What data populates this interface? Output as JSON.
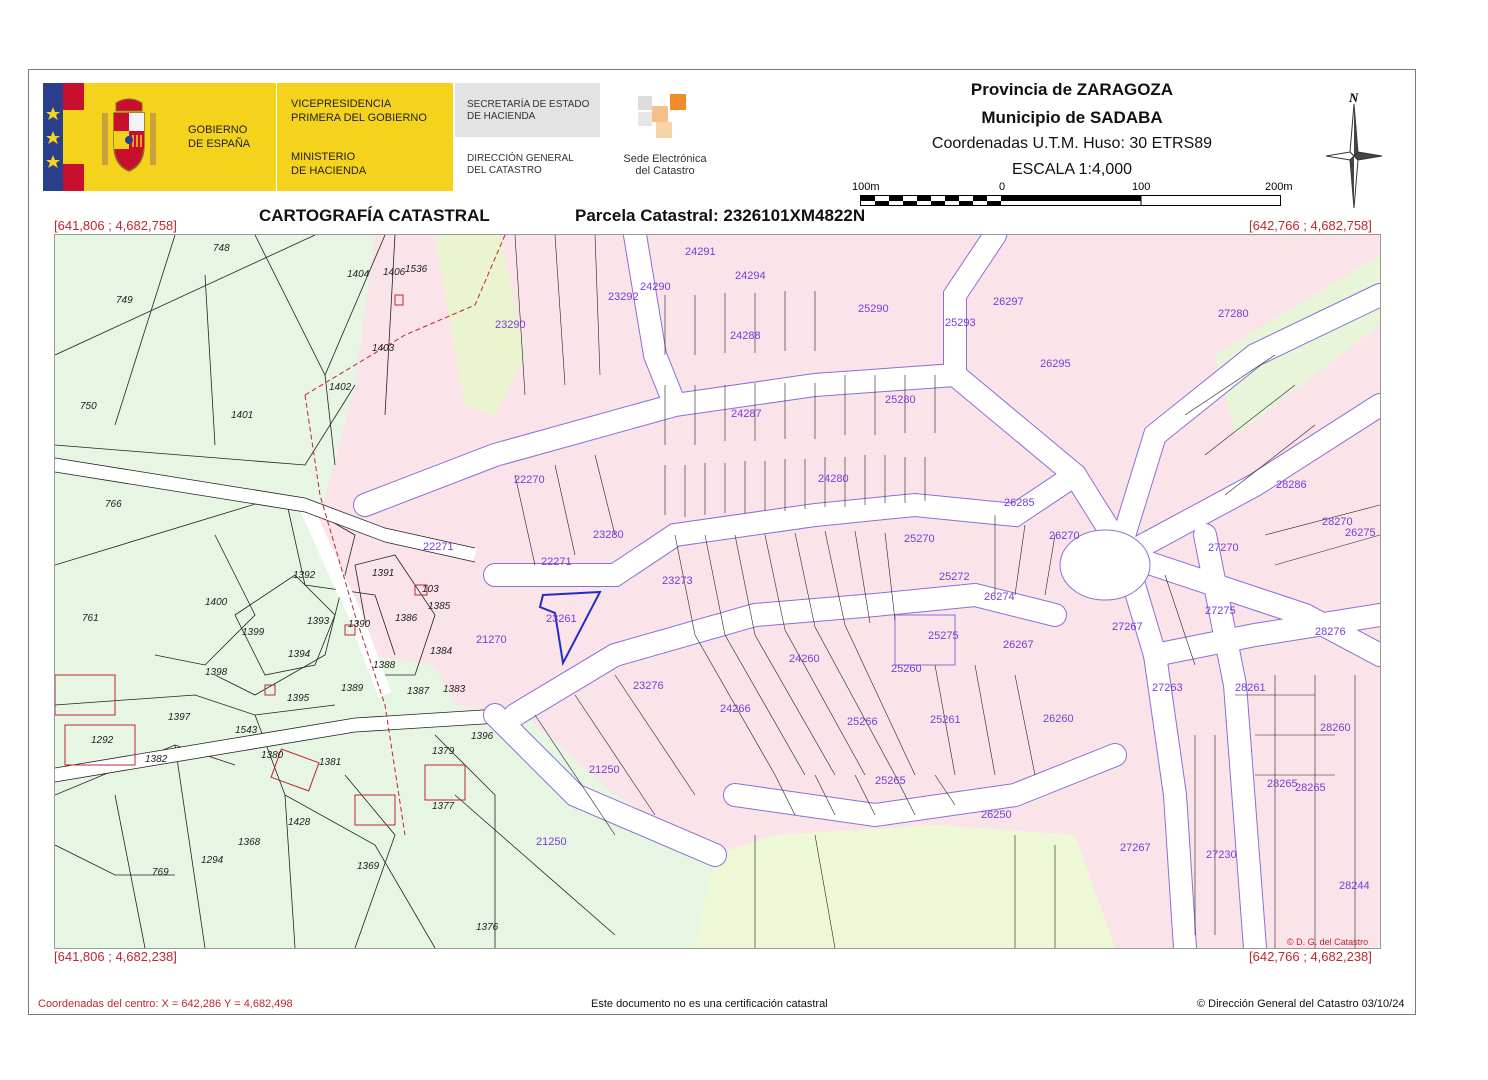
{
  "header": {
    "gobierno_line1": "GOBIERNO",
    "gobierno_line2": "DE ESPAÑA",
    "vp_line1": "VICEPRESIDENCIA",
    "vp_line2": "PRIMERA DEL GOBIERNO",
    "min_line1": "MINISTERIO",
    "min_line2": "DE HACIENDA",
    "se_line1": "SECRETARÍA DE ESTADO",
    "se_line2": "DE HACIENDA",
    "dg_line1": "DIRECCIÓN GENERAL",
    "dg_line2": "DEL CATASTRO",
    "sede_line1": "Sede Electrónica",
    "sede_line2": "del Catastro",
    "provincia_prefix": "Provincia de ",
    "provincia": "ZARAGOZA",
    "municipio_prefix": "Municipio de ",
    "municipio": "SADABA",
    "coordenadas": "Coordenadas U.T.M. Huso: 30 ETRS89",
    "escala": "ESCALA 1:4,000",
    "north": "N",
    "scale_labels": [
      "100m",
      "0",
      "100",
      "200m"
    ],
    "cartografia": "CARTOGRAFÍA CATASTRAL",
    "parcela": "Parcela Catastral: 2326101XM4822N"
  },
  "corners": {
    "top_left": "[641,806 ; 4,682,758]",
    "top_right": "[642,766 ; 4,682,758]",
    "bottom_left": "[641,806 ; 4,682,238]",
    "bottom_right": "[642,766 ; 4,682,238]"
  },
  "map": {
    "copyright_small": "© D. G. del Catastro",
    "urban_labels": [
      "24291",
      "24294",
      "23292",
      "24290",
      "23290",
      "24288",
      "25290",
      "26297",
      "25293",
      "27280",
      "26295",
      "24287",
      "25280",
      "22270",
      "24280",
      "26285",
      "28286",
      "23280",
      "26270",
      "28270",
      "22271",
      "22271",
      "25270",
      "26275",
      "27270",
      "23273",
      "25272",
      "26274",
      "23261",
      "21270",
      "25275",
      "26267",
      "27267",
      "27275",
      "28276",
      "24260",
      "25260",
      "23276",
      "27263",
      "28261",
      "24266",
      "25266",
      "25261",
      "26260",
      "28260",
      "21250",
      "25265",
      "28265",
      "28265",
      "26250",
      "21250",
      "27267",
      "27230",
      "28244"
    ],
    "rural_labels": [
      "748",
      "1404",
      "1406",
      "1536",
      "749",
      "1403",
      "1402",
      "750",
      "1401",
      "766",
      "1392",
      "1391",
      "103",
      "1385",
      "1400",
      "761",
      "1399",
      "1393",
      "1390",
      "1386",
      "1394",
      "1384",
      "1398",
      "1388",
      "1395",
      "1389",
      "1387",
      "1383",
      "1397",
      "1543",
      "1292",
      "1396",
      "1380",
      "1382",
      "1381",
      "1379",
      "1377",
      "1428",
      "1368",
      "1294",
      "1369",
      "769",
      "1376"
    ]
  },
  "footer": {
    "centro": "Coordenadas del centro: X = 642,286 Y = 4,682,498",
    "nota": "Este documento no es una certificación catastral",
    "copyright": "© Dirección General del Catastro 03/10/24"
  }
}
